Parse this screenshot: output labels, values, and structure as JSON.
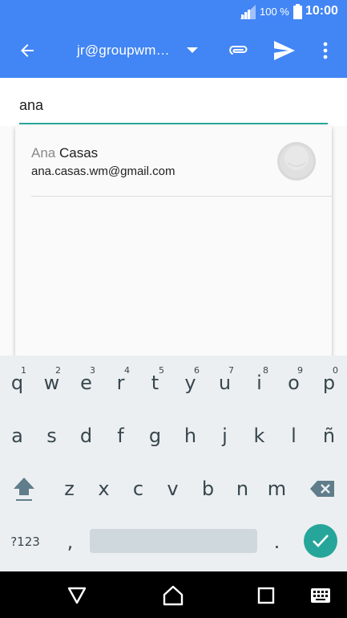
{
  "status_bar": {
    "battery_percent": "100 %",
    "time": "10:00"
  },
  "app_bar": {
    "from_account": "jr@groupwm…"
  },
  "compose": {
    "to_value": "ana"
  },
  "suggestion": {
    "name_match": "Ana",
    "name_rest": " Casas",
    "email": "ana.casas.wm@gmail.com"
  },
  "keyboard": {
    "row1": [
      {
        "key": "q",
        "hint": "1"
      },
      {
        "key": "w",
        "hint": "2"
      },
      {
        "key": "e",
        "hint": "3"
      },
      {
        "key": "r",
        "hint": "4"
      },
      {
        "key": "t",
        "hint": "5"
      },
      {
        "key": "y",
        "hint": "6"
      },
      {
        "key": "u",
        "hint": "7"
      },
      {
        "key": "i",
        "hint": "8"
      },
      {
        "key": "o",
        "hint": "9"
      },
      {
        "key": "p",
        "hint": "0"
      }
    ],
    "row2": [
      "a",
      "s",
      "d",
      "f",
      "g",
      "h",
      "j",
      "k",
      "l",
      "ñ"
    ],
    "row3": [
      "z",
      "x",
      "c",
      "v",
      "b",
      "n",
      "m"
    ],
    "symbols_label": "?123",
    "comma": ",",
    "period": "."
  },
  "colors": {
    "primary": "#4285f4",
    "accent": "#26a69a"
  },
  "icons": [
    "back-arrow-icon",
    "dropdown-arrow-icon",
    "attach-icon",
    "send-icon",
    "more-vert-icon",
    "shift-icon",
    "backspace-icon",
    "check-icon",
    "nav-back-icon",
    "nav-home-icon",
    "nav-recents-icon",
    "keyboard-switch-icon"
  ]
}
